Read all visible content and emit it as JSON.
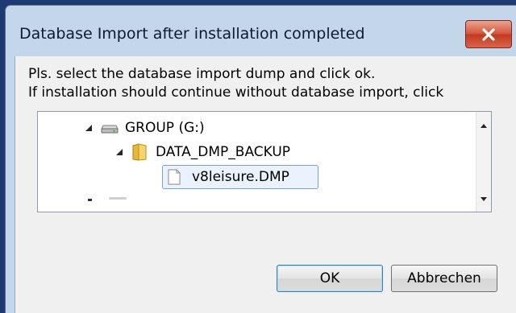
{
  "window": {
    "title": "Database Import after installation completed",
    "close_icon": "close-x-icon"
  },
  "message": {
    "line1": "Pls. select the database import dump and click ok.",
    "line2": "If installation should continue without database import, click"
  },
  "tree": {
    "drive": {
      "label": "GROUP (G:)",
      "icon": "drive-icon",
      "expanded": true
    },
    "folder": {
      "label": "DATA_DMP_BACKUP",
      "icon": "folder-icon",
      "expanded": true
    },
    "file": {
      "label": "v8leisure.DMP",
      "icon": "file-icon",
      "selected": true
    }
  },
  "buttons": {
    "ok": "OK",
    "cancel": "Abbrechen"
  },
  "colors": {
    "title_bar": "#c3d6ea",
    "close_button": "#d7553c",
    "selection_border": "#7da2ce",
    "dialog_bg": "#f0f0f0"
  }
}
